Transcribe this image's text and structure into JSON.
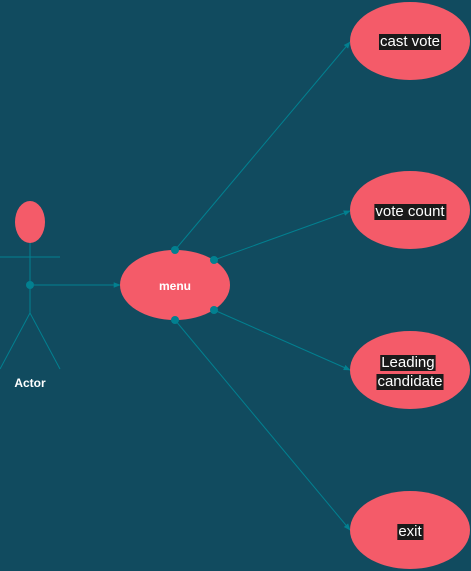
{
  "colors": {
    "background": "#114b5f",
    "node_fill": "#f45b69",
    "line": "#028090",
    "label_highlight": "#1a1a1a",
    "text": "#ffffff"
  },
  "actor": {
    "label": "Actor"
  },
  "menu": {
    "label": "menu"
  },
  "use_cases": [
    {
      "id": "cast-vote",
      "lines": [
        "cast vote"
      ]
    },
    {
      "id": "vote-count",
      "lines": [
        "vote count"
      ]
    },
    {
      "id": "leading-candidate",
      "lines": [
        "Leading",
        "candidate"
      ]
    },
    {
      "id": "exit",
      "lines": [
        "exit"
      ]
    }
  ]
}
